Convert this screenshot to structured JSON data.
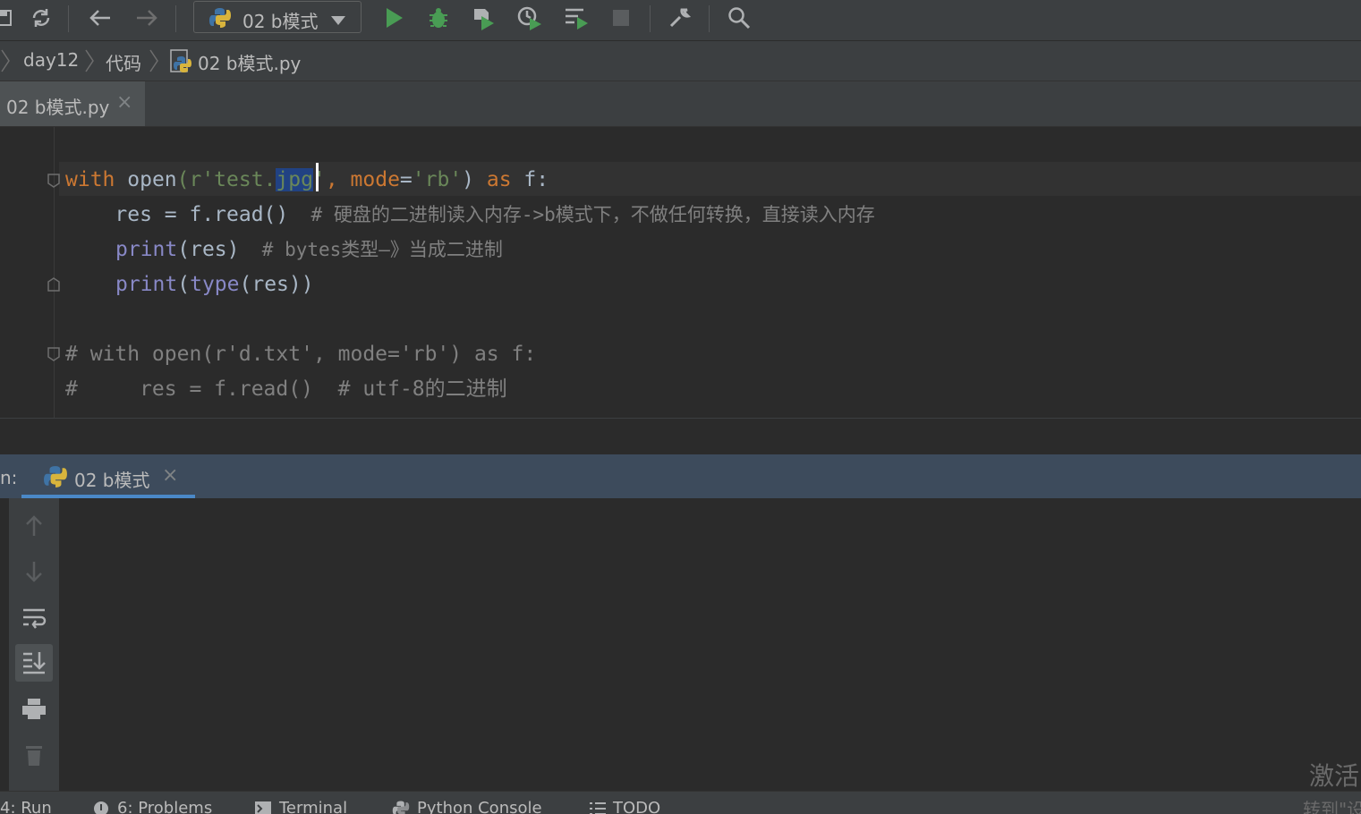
{
  "toolbar": {
    "run_config": "02 b模式",
    "icons": [
      "save-icon",
      "sync-icon",
      "back-arrow-icon",
      "forward-arrow-icon",
      "python-icon",
      "dropdown-icon",
      "run-icon",
      "debug-icon",
      "coverage-icon",
      "profile-icon",
      "concurrency-icon",
      "stop-icon",
      "wrench-icon",
      "search-icon"
    ],
    "colors": {
      "run": "#499c54",
      "debug": "#499c54"
    }
  },
  "breadcrumb": {
    "items": [
      "day12",
      "代码",
      "02 b模式.py"
    ]
  },
  "tabs": [
    {
      "label": "02 b模式.py",
      "close": "×",
      "active": true
    }
  ],
  "editor": {
    "lines": [
      {
        "kind": "code",
        "text": "with open(r'test.jpg', mode='rb') as f:"
      },
      {
        "kind": "code",
        "text": "    res = f.read()  # 硬盘的二进制读入内存->b模式下，不做任何转换，直接读入内存"
      },
      {
        "kind": "code",
        "text": "    print(res)  # bytes类型—》当成二进制"
      },
      {
        "kind": "code",
        "text": "    print(type(res))"
      },
      {
        "kind": "blank",
        "text": ""
      },
      {
        "kind": "comment",
        "text": "# with open(r'd.txt', mode='rb') as f:"
      },
      {
        "kind": "comment",
        "text": "#     res = f.read()  # utf-8的二进制"
      }
    ],
    "tokens": {
      "l1": {
        "kw_with": "with",
        "fn_open": "open",
        "s1": "(r'test.",
        "sel": "jpg",
        "s2": "'",
        "comma": ", ",
        "param": "mode",
        "eq": "=",
        "s3": "'rb'",
        "close": ") ",
        "kw_as": "as",
        "tail": " f:"
      },
      "l2": {
        "a": "    res = f.read()",
        "c": "  # 硬盘的二进制读入内存->b模式下，不做任何转换，直接读入内存"
      },
      "l3": {
        "fn": "print",
        "a": "(res)",
        "c": "  # bytes类型—》当成二进制"
      },
      "l4": {
        "fn1": "print",
        "p1": "(",
        "fn2": "type",
        "p2": "(res))"
      },
      "l6": "# with open(r'd.txt', mode='rb') as f:",
      "l7": "#     res = f.read()  # utf-8的二进制"
    },
    "colors": {
      "keyword": "#cc7832",
      "builtin": "#8888c6",
      "string": "#6a8759",
      "comment": "#808080",
      "selection": "#214283"
    }
  },
  "run_panel": {
    "prefix": "n:",
    "tab_label": "02 b模式",
    "tab_close": "×",
    "side_icons": [
      "up-arrow-icon",
      "down-arrow-icon",
      "soft-wrap-icon",
      "scroll-to-end-icon",
      "print-icon",
      "trash-icon"
    ]
  },
  "watermark": {
    "line1": "激活",
    "line2": "转到\"设"
  },
  "bottom_bar": {
    "items": [
      "4: Run",
      "6: Problems",
      "Terminal",
      "Python Console",
      "TODO"
    ]
  }
}
